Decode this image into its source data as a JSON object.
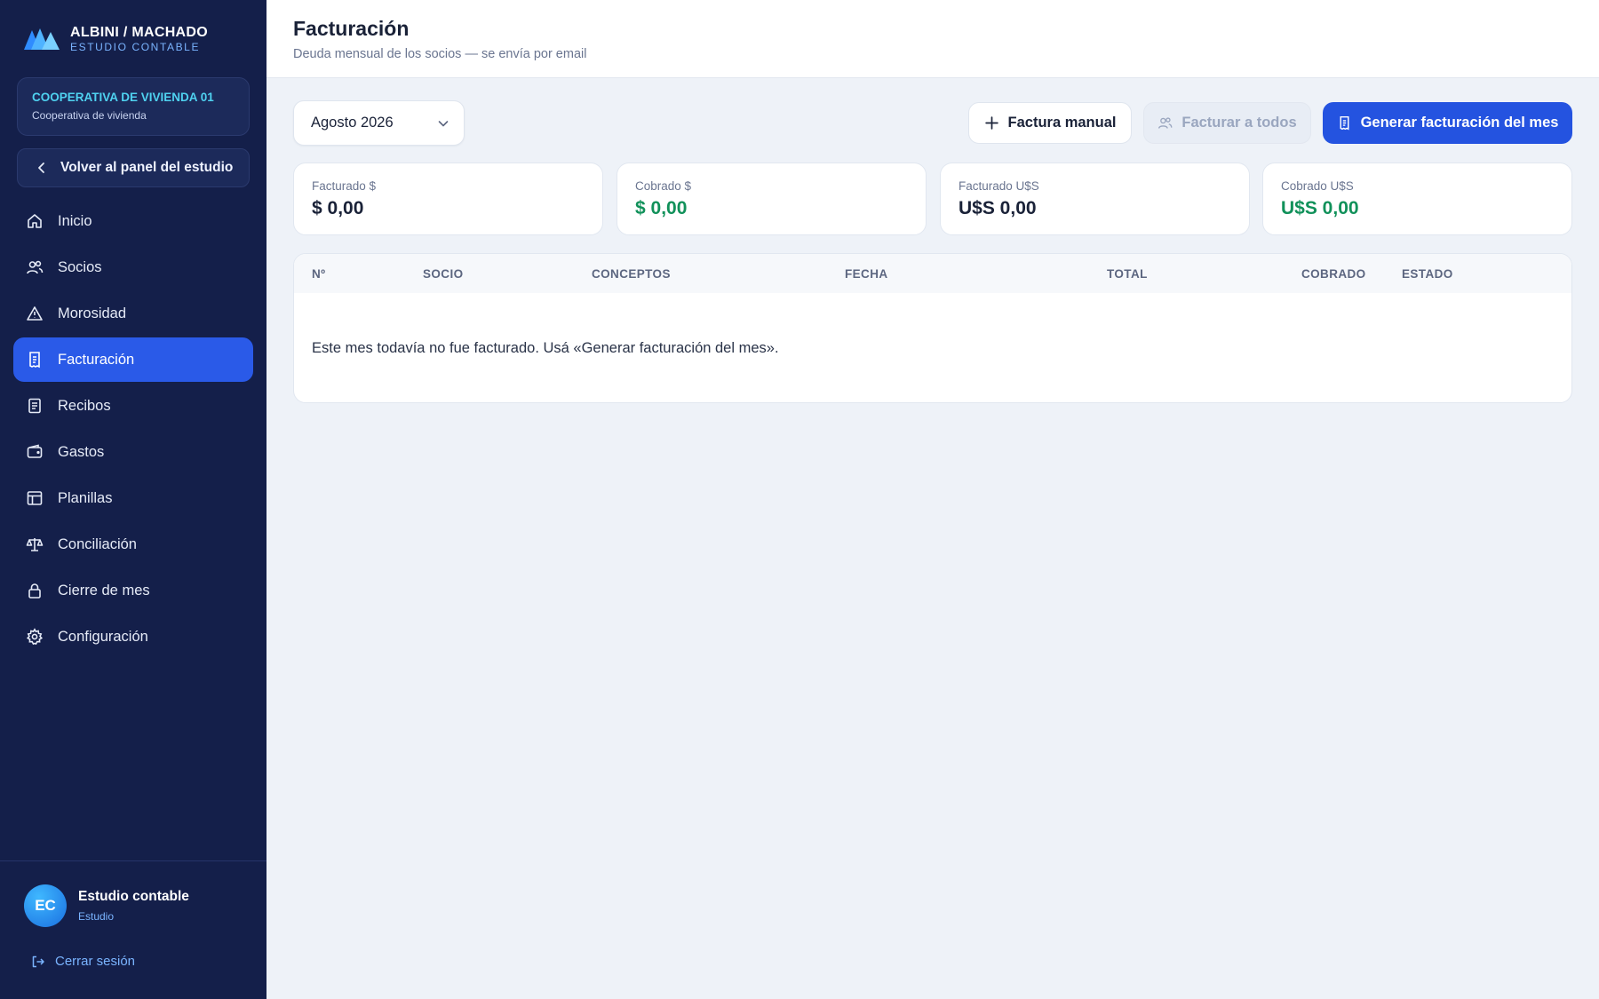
{
  "brand": {
    "name": "ALBINI / MACHADO",
    "subtitle": "ESTUDIO CONTABLE"
  },
  "cooperative": {
    "name": "COOPERATIVA DE VIVIENDA 01",
    "type": "Cooperativa de vivienda"
  },
  "sidebar": {
    "back_label": "Volver al panel del estudio",
    "items": [
      {
        "label": "Inicio",
        "icon": "home-icon"
      },
      {
        "label": "Socios",
        "icon": "users-icon"
      },
      {
        "label": "Morosidad",
        "icon": "alert-triangle-icon"
      },
      {
        "label": "Facturación",
        "icon": "receipt-icon",
        "active": true
      },
      {
        "label": "Recibos",
        "icon": "document-icon"
      },
      {
        "label": "Gastos",
        "icon": "wallet-icon"
      },
      {
        "label": "Planillas",
        "icon": "table-icon"
      },
      {
        "label": "Conciliación",
        "icon": "scale-icon"
      },
      {
        "label": "Cierre de mes",
        "icon": "lock-icon"
      },
      {
        "label": "Configuración",
        "icon": "gear-icon"
      }
    ]
  },
  "user": {
    "initials": "EC",
    "name": "Estudio contable",
    "role": "Estudio",
    "logout_label": "Cerrar sesión"
  },
  "header": {
    "title": "Facturación",
    "subtitle": "Deuda mensual de los socios — se envía por email"
  },
  "toolbar": {
    "month": "Agosto 2026",
    "manual_label": "Factura manual",
    "bill_all_label": "Facturar a todos",
    "generate_label": "Generar facturación del mes"
  },
  "stats": [
    {
      "label": "Facturado $",
      "value": "$ 0,00",
      "color": "#1a2238"
    },
    {
      "label": "Cobrado $",
      "value": "$ 0,00",
      "color": "#11915a"
    },
    {
      "label": "Facturado U$S",
      "value": "U$S 0,00",
      "color": "#1a2238"
    },
    {
      "label": "Cobrado U$S",
      "value": "U$S 0,00",
      "color": "#11915a"
    }
  ],
  "table": {
    "columns": [
      "Nº",
      "SOCIO",
      "CONCEPTOS",
      "FECHA",
      "TOTAL",
      "COBRADO",
      "ESTADO"
    ],
    "rows": [],
    "empty_message": "Este mes todavía no fue facturado. Usá «Generar facturación del mes»."
  },
  "colors": {
    "sidebar_bg": "#141f4a",
    "accent": "#2453e0",
    "active_nav": "#2a5ae8",
    "positive": "#11915a"
  }
}
